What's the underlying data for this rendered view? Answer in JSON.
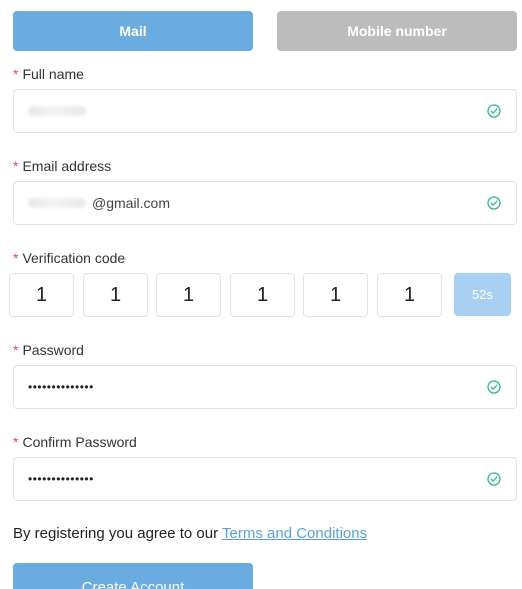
{
  "tabs": {
    "mail": "Mail",
    "mobile": "Mobile number"
  },
  "form": {
    "required_mark": "*",
    "full_name": {
      "label": "Full name",
      "value": ""
    },
    "email": {
      "label": "Email address",
      "value": "@gmail.com"
    },
    "verification": {
      "label": "Verification code",
      "digits": [
        "1",
        "1",
        "1",
        "1",
        "1",
        "1"
      ],
      "resend_countdown": "52s"
    },
    "password": {
      "label": "Password",
      "value": "••••••••••••••"
    },
    "confirm_password": {
      "label": "Confirm Password",
      "value": "••••••••••••••"
    }
  },
  "agreement": {
    "text": "By registering you agree to our ",
    "link": "Terms and Conditions"
  },
  "submit": {
    "label": "Create Account"
  },
  "colors": {
    "primary": "#6aabe0",
    "inactive_tab": "#bcbcbc",
    "required": "#e5484d",
    "valid_check": "#2fb884",
    "resend_disabled": "#a9cff2",
    "link": "#5aa2d6"
  },
  "icons": {
    "valid": "check-circle-icon"
  }
}
